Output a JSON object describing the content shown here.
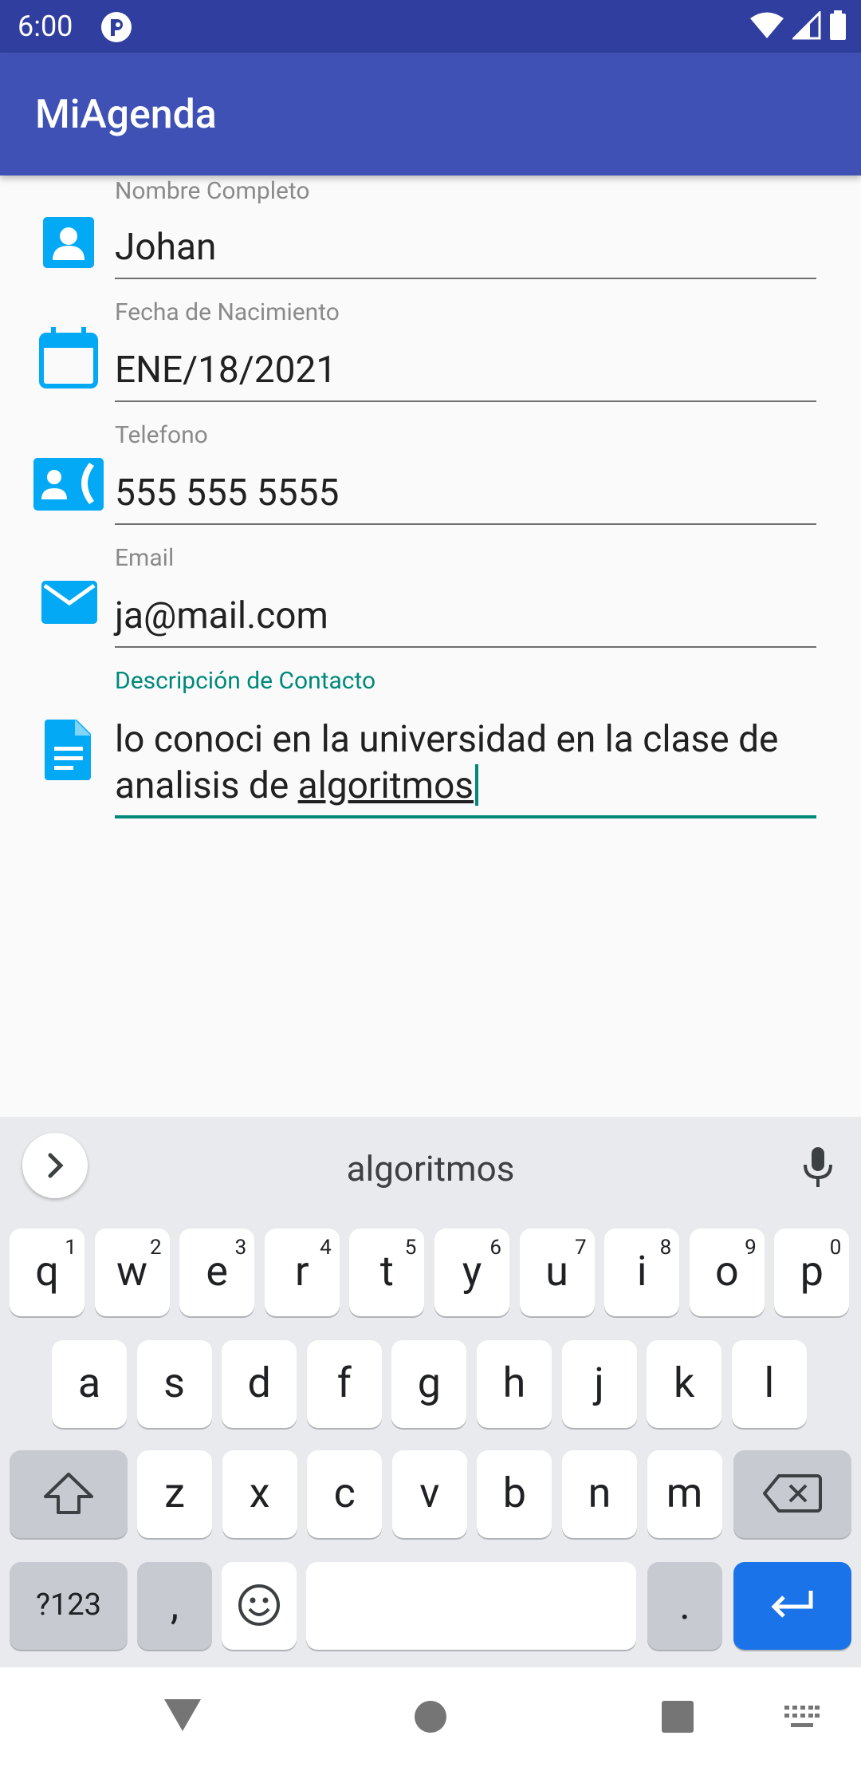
{
  "status": {
    "time": "6:00"
  },
  "app": {
    "title": "MiAgenda"
  },
  "form": {
    "nombre": {
      "label": "Nombre Completo",
      "value": "Johan"
    },
    "fecha": {
      "label": "Fecha de Nacimiento",
      "value": "ENE/18/2021"
    },
    "telefono": {
      "label": "Telefono",
      "value": "555 555 5555"
    },
    "email": {
      "label": "Email",
      "value": "ja@mail.com"
    },
    "descripcion": {
      "label": "Descripción de Contacto",
      "value_part1": "lo conoci en la universidad en la clase de analisis de ",
      "value_part2": "algoritmos"
    }
  },
  "keyboard": {
    "suggestion": "algoritmos",
    "row1": [
      {
        "k": "q",
        "n": "1"
      },
      {
        "k": "w",
        "n": "2"
      },
      {
        "k": "e",
        "n": "3"
      },
      {
        "k": "r",
        "n": "4"
      },
      {
        "k": "t",
        "n": "5"
      },
      {
        "k": "y",
        "n": "6"
      },
      {
        "k": "u",
        "n": "7"
      },
      {
        "k": "i",
        "n": "8"
      },
      {
        "k": "o",
        "n": "9"
      },
      {
        "k": "p",
        "n": "0"
      }
    ],
    "row2": [
      "a",
      "s",
      "d",
      "f",
      "g",
      "h",
      "j",
      "k",
      "l"
    ],
    "row3": [
      "z",
      "x",
      "c",
      "v",
      "b",
      "n",
      "m"
    ],
    "symbols_key": "?123",
    "comma_key": ",",
    "period_key": "."
  },
  "colors": {
    "appbar": "#3f51b5",
    "statusbar": "#303f9f",
    "accent": "#00897b",
    "icon": "#03a9f4",
    "enter": "#1a73e8"
  }
}
